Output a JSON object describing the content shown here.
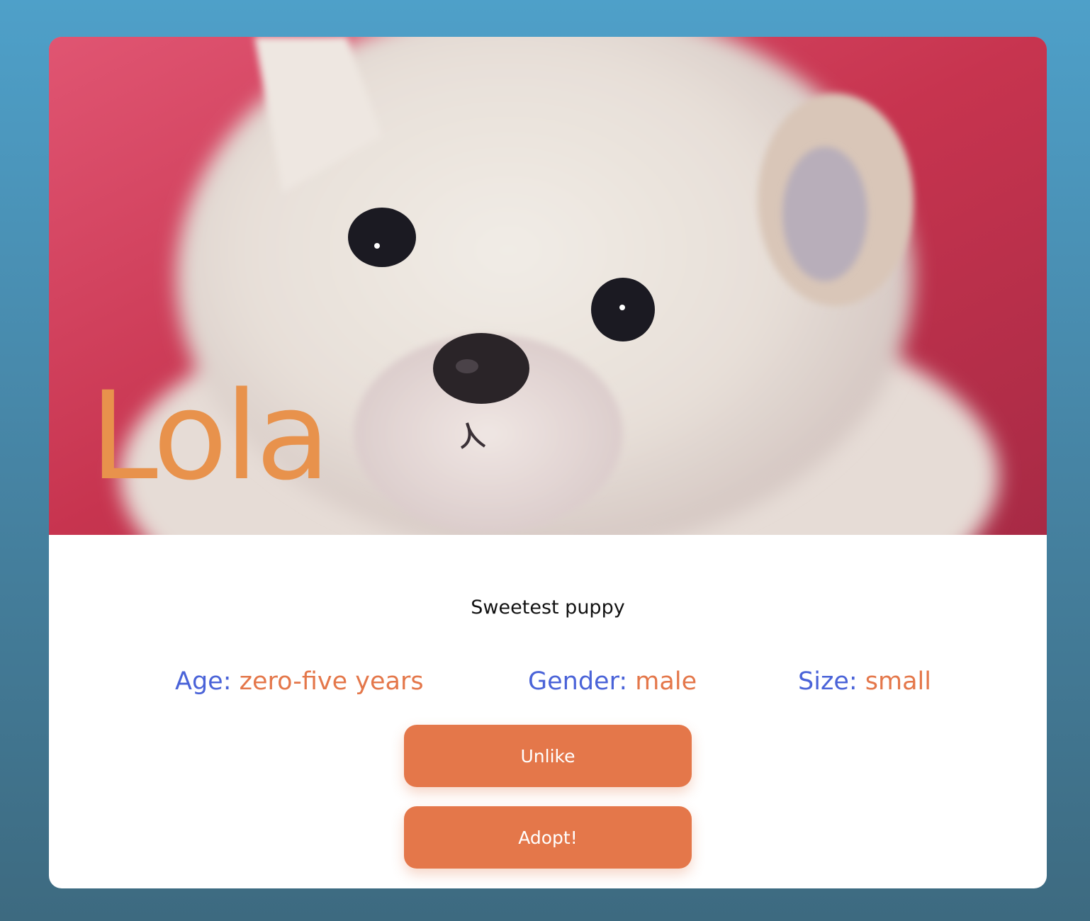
{
  "colors": {
    "accent_orange": "#e4774a",
    "name_orange": "#e8924c",
    "label_blue": "#4a63d8",
    "text_dark": "#111111"
  },
  "pet": {
    "name": "Lola",
    "photo": "white-puppy-photo",
    "description": "Sweetest puppy",
    "attributes": [
      {
        "label": "Age:",
        "value": "zero-five years"
      },
      {
        "label": "Gender:",
        "value": "male"
      },
      {
        "label": "Size:",
        "value": "small"
      }
    ]
  },
  "actions": {
    "unlike_label": "Unlike",
    "adopt_label": "Adopt!"
  }
}
